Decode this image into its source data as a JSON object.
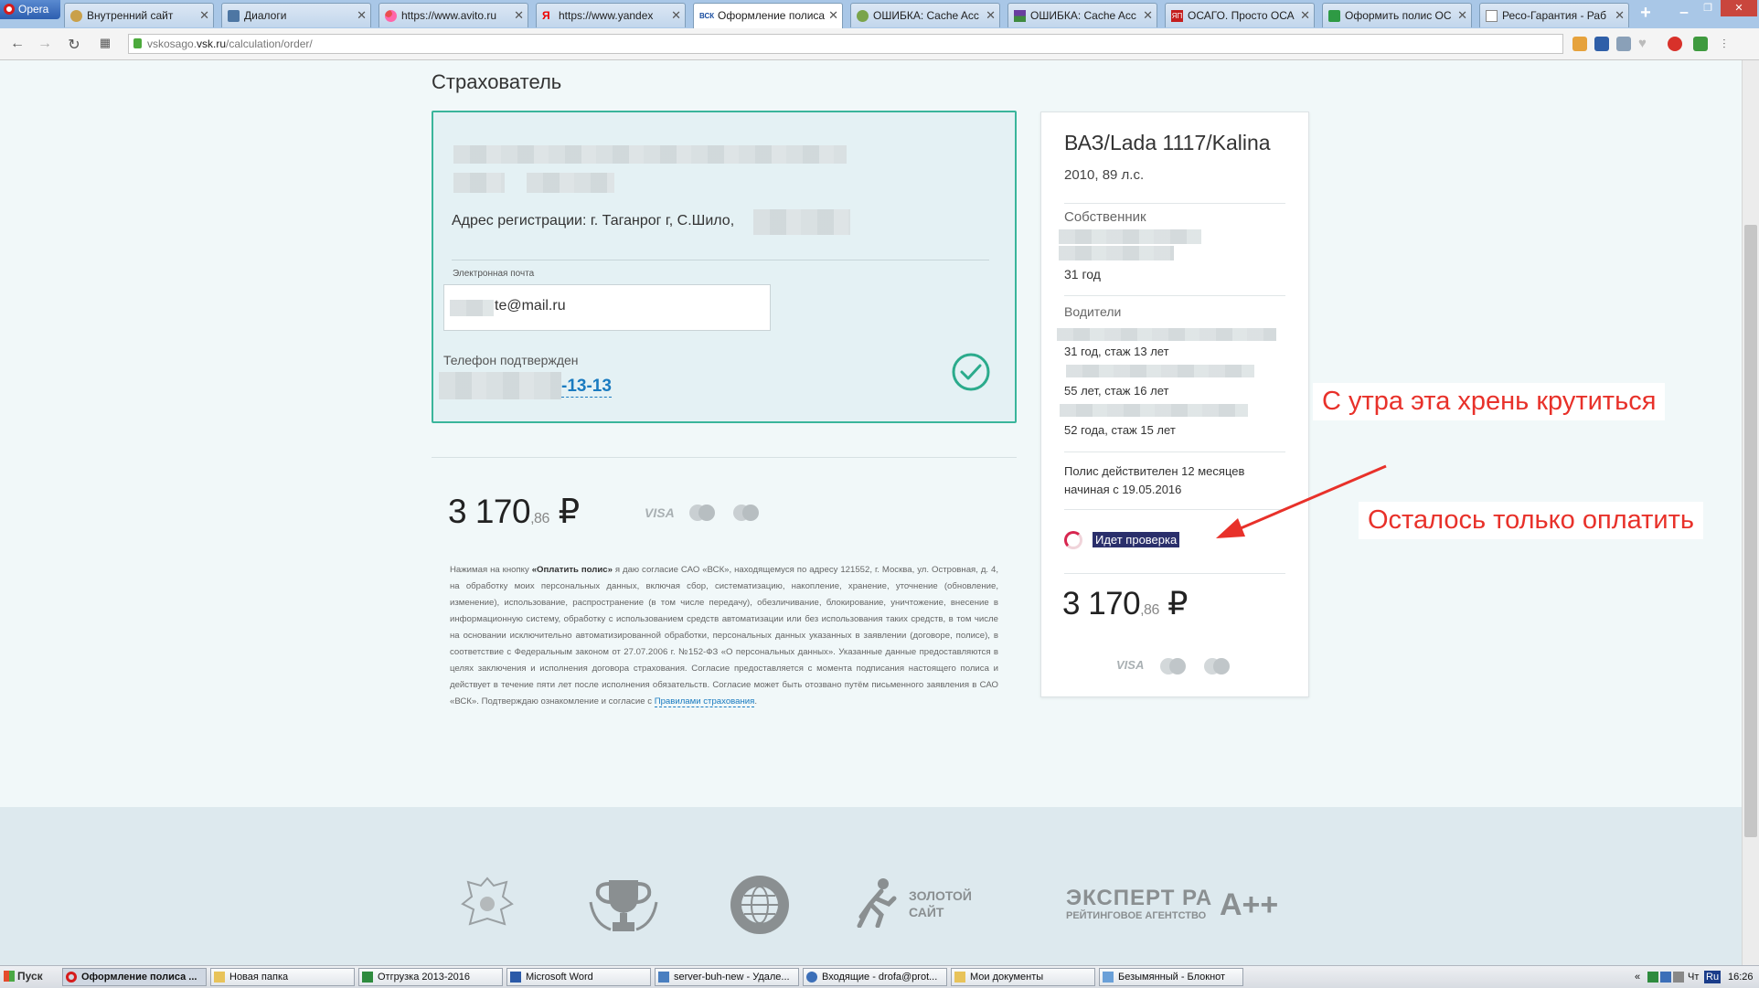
{
  "browser": {
    "menu_label": "Opera",
    "tabs": [
      {
        "label": "Внутренний сайт"
      },
      {
        "label": "Диалоги"
      },
      {
        "label": "https://www.avito.ru"
      },
      {
        "label": "https://www.yandex"
      },
      {
        "label": "Оформление полиса"
      },
      {
        "label": "ОШИБКА: Cache Acc"
      },
      {
        "label": "ОШИБКА: Cache Acc"
      },
      {
        "label": "ОСАГО. Просто ОСА"
      },
      {
        "label": "Оформить полис ОС"
      },
      {
        "label": "Ресо-Гарантия - Раб"
      }
    ],
    "new_tab": "+",
    "url_prefix": "vskosago.",
    "url_domain": "vsk.ru",
    "url_path": "/calculation/order/"
  },
  "page": {
    "insurer_heading": "Страхователь",
    "address": "Адрес регистрации: г. Таганрог г, С.Шило,",
    "email_label": "Электронная почта",
    "email_value": "te@mail.ru",
    "phone_label": "Телефон подтвержден",
    "phone_value": "-13-13",
    "price_main": "3 170",
    "price_kop": ",86",
    "currency": "₽",
    "pay_visa": "VISA",
    "legal_1": "Нажимая на кнопку ",
    "legal_bold": "«Оплатить полис»",
    "legal_2": " я даю согласие САО «ВСК», находящемуся по адресу 121552, г. Москва, ул. Островная, д. 4, на обработку моих персональных данных, включая сбор, систематизацию, накопление, хранение, уточнение (обновление, изменение), использование, распространение (в том числе передачу), обезличивание, блокирование, уничтожение, внесение в информационную систему, обработку с использованием средств автоматизации или без использования таких средств, в том числе на основании исключительно автоматизированной обработки, персональных данных указанных в заявлении (договоре, полисе), в соответствие с Федеральным законом от 27.07.2006 г. №152-ФЗ «О персональных данных». Указанные данные предоставляются в целях заключения и исполнения договора страхования. Согласие предоставляется с момента подписания настоящего полиса и действует в течение пяти лет после исполнения обязательств. Согласие может быть отозвано путём письменного заявления в САО «ВСК». Подтверждаю ознакомление и согласие с ",
    "legal_link": "Правилами страхования",
    "legal_end": "."
  },
  "sidebar": {
    "car": "ВАЗ/Lada 1117/Kalina",
    "year": "2010, 89 л.с.",
    "owner_label": "Собственник",
    "owner_age": "31 год",
    "drivers_label": "Водители",
    "drivers": [
      {
        "text": "31 год, стаж 13 лет"
      },
      {
        "text": "55 лет, стаж 16 лет"
      },
      {
        "text": "52 года, стаж 15 лет"
      }
    ],
    "policy_line1": "Полис действителен 12 месяцев",
    "policy_line2": "начиная с 19.05.2016",
    "checking": "Идет проверка",
    "price_main": "3 170",
    "price_kop": ",86",
    "currency": "₽",
    "pay_visa": "VISA"
  },
  "annotations": {
    "note1": "С утра эта хрень крутиться",
    "note2": "Осталось только оплатить",
    "color": "#e8312a"
  },
  "footer": {
    "logo_golden_line1": "ЗОЛОТОЙ",
    "logo_golden_line2": "САЙТ",
    "logo_expert": "ЭКСПЕРТ РА",
    "logo_expert_sub": "РЕЙТИНГОВОЕ АГЕНТСТВО",
    "logo_rating": "A++"
  },
  "taskbar": {
    "start": "Пуск",
    "items": [
      {
        "label": "Оформление полиса ..."
      },
      {
        "label": "Новая папка"
      },
      {
        "label": "Отгрузка 2013-2016"
      },
      {
        "label": "Microsoft Word"
      },
      {
        "label": "server-buh-new - Удале..."
      },
      {
        "label": "Входящие - drofa@prot..."
      },
      {
        "label": "Мои документы"
      },
      {
        "label": "Безымянный - Блокнот"
      }
    ],
    "lang": "Ru",
    "day": "Чт",
    "time": "16:26"
  },
  "colors": {
    "accent_green": "#3ab59b",
    "link_blue": "#1a7bc0",
    "spinner": "#d7264f"
  }
}
